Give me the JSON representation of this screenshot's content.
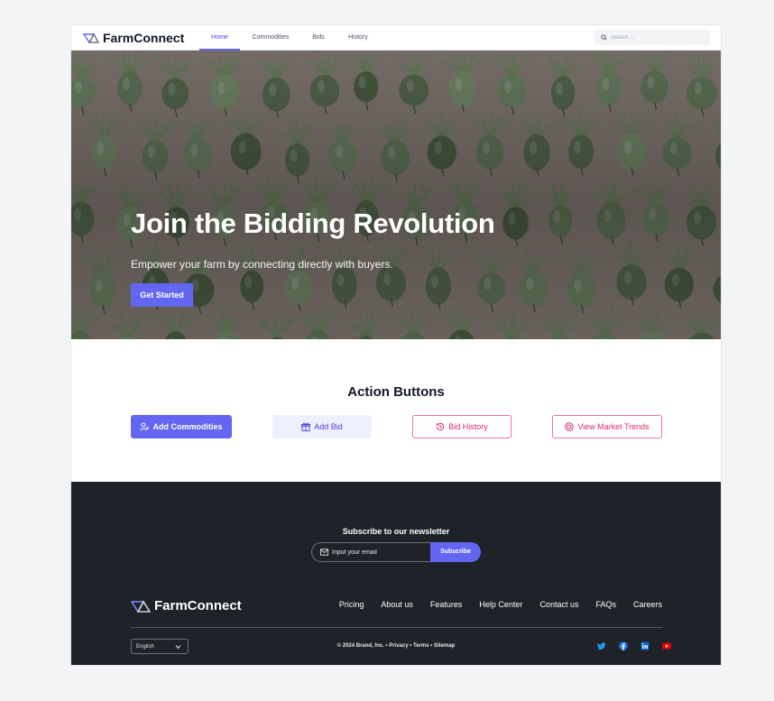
{
  "nav": {
    "brand": "FarmConnect",
    "links": [
      "Home",
      "Commodities",
      "Bids",
      "History"
    ],
    "active": "Home",
    "search_placeholder": "Search ..."
  },
  "hero": {
    "title": "Join the Bidding Revolution",
    "subtitle": "Empower your farm by connecting directly with buyers.",
    "cta": "Get Started"
  },
  "actions": {
    "title": "Action Buttons",
    "buttons": [
      "Add Commodities",
      "Add Bid",
      "Bid History",
      "View Market Trends"
    ]
  },
  "footer": {
    "newsletter_title": "Subscribe to our newsletter",
    "email_placeholder": "Input your email",
    "subscribe": "Subscribe",
    "brand": "FarmConnect",
    "links": [
      "Pricing",
      "About us",
      "Features",
      "Help Center",
      "Contact us",
      "FAQs",
      "Careers"
    ],
    "language": "English",
    "copyright": "© 2024 Brand, Inc. • Privacy • Terms • Sitemap",
    "socials": [
      "twitter-icon",
      "facebook-icon",
      "linkedin-icon",
      "youtube-icon"
    ]
  },
  "colors": {
    "accent": "#6366f1",
    "accent_soft": "#eef0fd",
    "pink": "#db2777",
    "footer_bg": "#1f2228"
  }
}
